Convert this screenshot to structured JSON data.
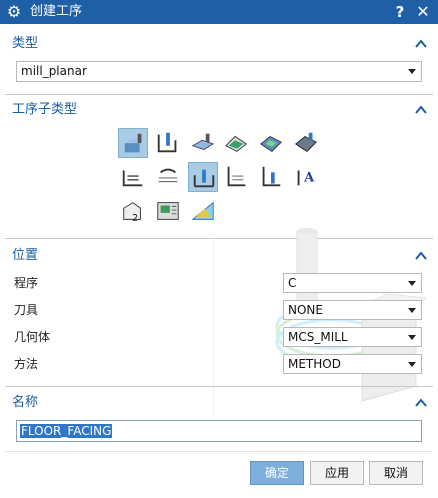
{
  "window": {
    "title": "创建工序",
    "help_label": "?",
    "close_label": "✕"
  },
  "type_section": {
    "label": "类型",
    "selected": "mill_planar"
  },
  "subtype_section": {
    "label": "工序子类型",
    "tools": [
      {
        "name": "floor-wall-icon",
        "selected": true
      },
      {
        "name": "floor-wall-ipw-icon",
        "selected": false
      },
      {
        "name": "face-milling-icon",
        "selected": false
      },
      {
        "name": "face-milling-manual-icon",
        "selected": false
      },
      {
        "name": "face-milling-area-icon",
        "selected": false
      },
      {
        "name": "planar-mill-icon",
        "selected": false
      },
      {
        "name": "planar-profile-icon",
        "selected": false
      },
      {
        "name": "clean-up-corners-icon",
        "selected": false
      },
      {
        "name": "floor-facing-icon",
        "selected": true
      },
      {
        "name": "finish-walls-icon",
        "selected": false
      },
      {
        "name": "finish-floor-icon",
        "selected": false
      },
      {
        "name": "planar-text-icon",
        "selected": false
      },
      {
        "name": "mill-control-icon",
        "selected": false
      },
      {
        "name": "mill-user-icon",
        "selected": false
      },
      {
        "name": "slot-milling-icon",
        "selected": false
      }
    ]
  },
  "position_section": {
    "label": "位置",
    "rows": [
      {
        "label": "程序",
        "value": "C"
      },
      {
        "label": "刀具",
        "value": "NONE"
      },
      {
        "label": "几何体",
        "value": "MCS_MILL"
      },
      {
        "label": "方法",
        "value": "METHOD"
      }
    ]
  },
  "name_section": {
    "label": "名称",
    "value": "FLOOR_FACING"
  },
  "buttons": {
    "ok": "确定",
    "apply": "应用",
    "cancel": "取消"
  },
  "colors": {
    "title_bar": "#1f5fa6",
    "section_label": "#1b5ea3",
    "selection": "#2f76c7",
    "primary_button": "#7eaedb"
  }
}
